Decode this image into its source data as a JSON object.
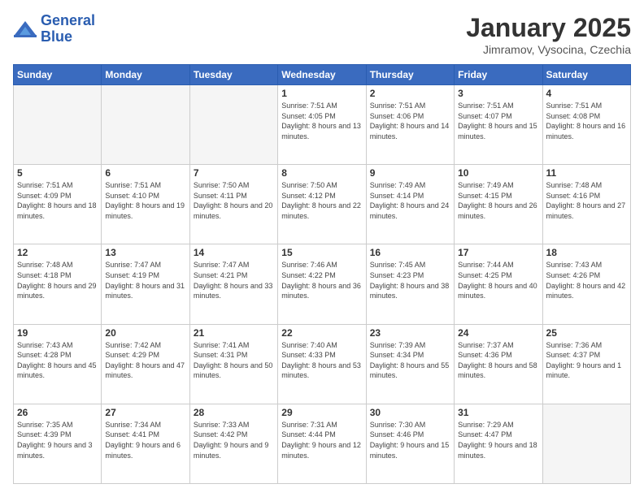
{
  "header": {
    "logo_line1": "General",
    "logo_line2": "Blue",
    "title": "January 2025",
    "subtitle": "Jimramov, Vysocina, Czechia"
  },
  "weekdays": [
    "Sunday",
    "Monday",
    "Tuesday",
    "Wednesday",
    "Thursday",
    "Friday",
    "Saturday"
  ],
  "weeks": [
    [
      {
        "day": "",
        "info": ""
      },
      {
        "day": "",
        "info": ""
      },
      {
        "day": "",
        "info": ""
      },
      {
        "day": "1",
        "info": "Sunrise: 7:51 AM\nSunset: 4:05 PM\nDaylight: 8 hours\nand 13 minutes."
      },
      {
        "day": "2",
        "info": "Sunrise: 7:51 AM\nSunset: 4:06 PM\nDaylight: 8 hours\nand 14 minutes."
      },
      {
        "day": "3",
        "info": "Sunrise: 7:51 AM\nSunset: 4:07 PM\nDaylight: 8 hours\nand 15 minutes."
      },
      {
        "day": "4",
        "info": "Sunrise: 7:51 AM\nSunset: 4:08 PM\nDaylight: 8 hours\nand 16 minutes."
      }
    ],
    [
      {
        "day": "5",
        "info": "Sunrise: 7:51 AM\nSunset: 4:09 PM\nDaylight: 8 hours\nand 18 minutes."
      },
      {
        "day": "6",
        "info": "Sunrise: 7:51 AM\nSunset: 4:10 PM\nDaylight: 8 hours\nand 19 minutes."
      },
      {
        "day": "7",
        "info": "Sunrise: 7:50 AM\nSunset: 4:11 PM\nDaylight: 8 hours\nand 20 minutes."
      },
      {
        "day": "8",
        "info": "Sunrise: 7:50 AM\nSunset: 4:12 PM\nDaylight: 8 hours\nand 22 minutes."
      },
      {
        "day": "9",
        "info": "Sunrise: 7:49 AM\nSunset: 4:14 PM\nDaylight: 8 hours\nand 24 minutes."
      },
      {
        "day": "10",
        "info": "Sunrise: 7:49 AM\nSunset: 4:15 PM\nDaylight: 8 hours\nand 26 minutes."
      },
      {
        "day": "11",
        "info": "Sunrise: 7:48 AM\nSunset: 4:16 PM\nDaylight: 8 hours\nand 27 minutes."
      }
    ],
    [
      {
        "day": "12",
        "info": "Sunrise: 7:48 AM\nSunset: 4:18 PM\nDaylight: 8 hours\nand 29 minutes."
      },
      {
        "day": "13",
        "info": "Sunrise: 7:47 AM\nSunset: 4:19 PM\nDaylight: 8 hours\nand 31 minutes."
      },
      {
        "day": "14",
        "info": "Sunrise: 7:47 AM\nSunset: 4:21 PM\nDaylight: 8 hours\nand 33 minutes."
      },
      {
        "day": "15",
        "info": "Sunrise: 7:46 AM\nSunset: 4:22 PM\nDaylight: 8 hours\nand 36 minutes."
      },
      {
        "day": "16",
        "info": "Sunrise: 7:45 AM\nSunset: 4:23 PM\nDaylight: 8 hours\nand 38 minutes."
      },
      {
        "day": "17",
        "info": "Sunrise: 7:44 AM\nSunset: 4:25 PM\nDaylight: 8 hours\nand 40 minutes."
      },
      {
        "day": "18",
        "info": "Sunrise: 7:43 AM\nSunset: 4:26 PM\nDaylight: 8 hours\nand 42 minutes."
      }
    ],
    [
      {
        "day": "19",
        "info": "Sunrise: 7:43 AM\nSunset: 4:28 PM\nDaylight: 8 hours\nand 45 minutes."
      },
      {
        "day": "20",
        "info": "Sunrise: 7:42 AM\nSunset: 4:29 PM\nDaylight: 8 hours\nand 47 minutes."
      },
      {
        "day": "21",
        "info": "Sunrise: 7:41 AM\nSunset: 4:31 PM\nDaylight: 8 hours\nand 50 minutes."
      },
      {
        "day": "22",
        "info": "Sunrise: 7:40 AM\nSunset: 4:33 PM\nDaylight: 8 hours\nand 53 minutes."
      },
      {
        "day": "23",
        "info": "Sunrise: 7:39 AM\nSunset: 4:34 PM\nDaylight: 8 hours\nand 55 minutes."
      },
      {
        "day": "24",
        "info": "Sunrise: 7:37 AM\nSunset: 4:36 PM\nDaylight: 8 hours\nand 58 minutes."
      },
      {
        "day": "25",
        "info": "Sunrise: 7:36 AM\nSunset: 4:37 PM\nDaylight: 9 hours\nand 1 minute."
      }
    ],
    [
      {
        "day": "26",
        "info": "Sunrise: 7:35 AM\nSunset: 4:39 PM\nDaylight: 9 hours\nand 3 minutes."
      },
      {
        "day": "27",
        "info": "Sunrise: 7:34 AM\nSunset: 4:41 PM\nDaylight: 9 hours\nand 6 minutes."
      },
      {
        "day": "28",
        "info": "Sunrise: 7:33 AM\nSunset: 4:42 PM\nDaylight: 9 hours\nand 9 minutes."
      },
      {
        "day": "29",
        "info": "Sunrise: 7:31 AM\nSunset: 4:44 PM\nDaylight: 9 hours\nand 12 minutes."
      },
      {
        "day": "30",
        "info": "Sunrise: 7:30 AM\nSunset: 4:46 PM\nDaylight: 9 hours\nand 15 minutes."
      },
      {
        "day": "31",
        "info": "Sunrise: 7:29 AM\nSunset: 4:47 PM\nDaylight: 9 hours\nand 18 minutes."
      },
      {
        "day": "",
        "info": ""
      }
    ]
  ]
}
